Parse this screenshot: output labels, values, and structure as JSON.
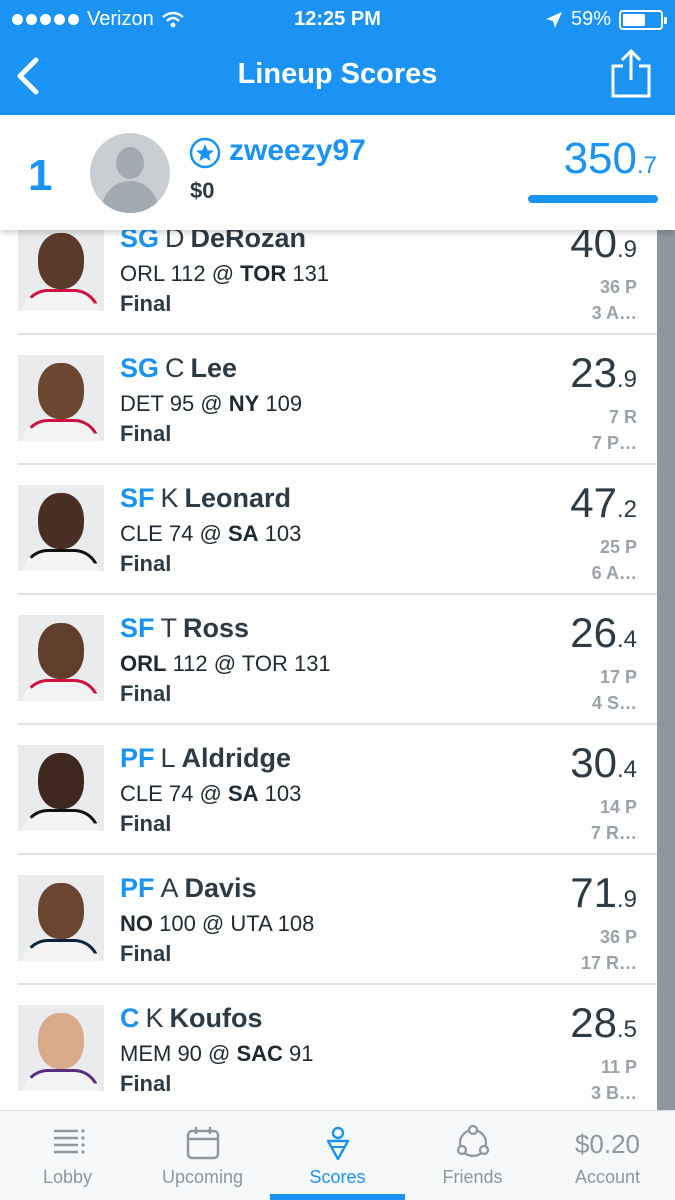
{
  "status_bar": {
    "carrier": "Verizon",
    "time": "12:25 PM",
    "battery": "59%",
    "battery_level": 0.59
  },
  "nav": {
    "title": "Lineup Scores",
    "back_icon": "chevron-left-icon",
    "share_icon": "share-icon"
  },
  "user": {
    "rank": "1",
    "username": "zweezy97",
    "balance": "$0",
    "total_int": "350",
    "total_dec": ".7",
    "progress": 1.0
  },
  "players": [
    {
      "pos": "SG",
      "initial": "D",
      "last": "DeRozan",
      "game_pre": "ORL 112 @ ",
      "game_bold": "TOR",
      "game_post": " 131",
      "game_bold_first": false,
      "status": "Final",
      "pts_int": "40",
      "pts_dec": ".9",
      "stat1": "36 P",
      "stat2": "3 A…"
    },
    {
      "pos": "SG",
      "initial": "C",
      "last": "Lee",
      "game_pre": "DET 95 @ ",
      "game_bold": "NY",
      "game_post": " 109",
      "game_bold_first": false,
      "status": "Final",
      "pts_int": "23",
      "pts_dec": ".9",
      "stat1": "7 R",
      "stat2": "7 P…"
    },
    {
      "pos": "SF",
      "initial": "K",
      "last": "Leonard",
      "game_pre": "CLE 74 @ ",
      "game_bold": "SA",
      "game_post": " 103",
      "game_bold_first": false,
      "status": "Final",
      "pts_int": "47",
      "pts_dec": ".2",
      "stat1": "25 P",
      "stat2": "6 A…"
    },
    {
      "pos": "SF",
      "initial": "T",
      "last": "Ross",
      "game_pre": "",
      "game_bold": "ORL",
      "game_post": " 112 @ TOR 131",
      "game_bold_first": true,
      "status": "Final",
      "pts_int": "26",
      "pts_dec": ".4",
      "stat1": "17 P",
      "stat2": "4 S…"
    },
    {
      "pos": "PF",
      "initial": "L",
      "last": "Aldridge",
      "game_pre": "CLE 74 @ ",
      "game_bold": "SA",
      "game_post": " 103",
      "game_bold_first": false,
      "status": "Final",
      "pts_int": "30",
      "pts_dec": ".4",
      "stat1": "14 P",
      "stat2": "7 R…"
    },
    {
      "pos": "PF",
      "initial": "A",
      "last": "Davis",
      "game_pre": "",
      "game_bold": "NO",
      "game_post": " 100 @ UTA 108",
      "game_bold_first": true,
      "status": "Final",
      "pts_int": "71",
      "pts_dec": ".9",
      "stat1": "36 P",
      "stat2": "17 R…"
    },
    {
      "pos": "C",
      "initial": "K",
      "last": "Koufos",
      "game_pre": "MEM 90 @ ",
      "game_bold": "SAC",
      "game_post": " 91",
      "game_bold_first": false,
      "status": "Final",
      "pts_int": "28",
      "pts_dec": ".5",
      "stat1": "11 P",
      "stat2": "3 B…"
    }
  ],
  "tabs": [
    {
      "label": "Lobby",
      "icon": "list-icon"
    },
    {
      "label": "Upcoming",
      "icon": "calendar-icon"
    },
    {
      "label": "Scores",
      "icon": "scores-icon"
    },
    {
      "label": "Friends",
      "icon": "friends-icon"
    },
    {
      "label": "Account",
      "icon": "account-balance",
      "value": "$0.20"
    }
  ],
  "colors": {
    "brand": "#1a93f5",
    "text": "#2e3a44",
    "muted": "#9aa3ab",
    "scrollbar": "#8e979f"
  }
}
